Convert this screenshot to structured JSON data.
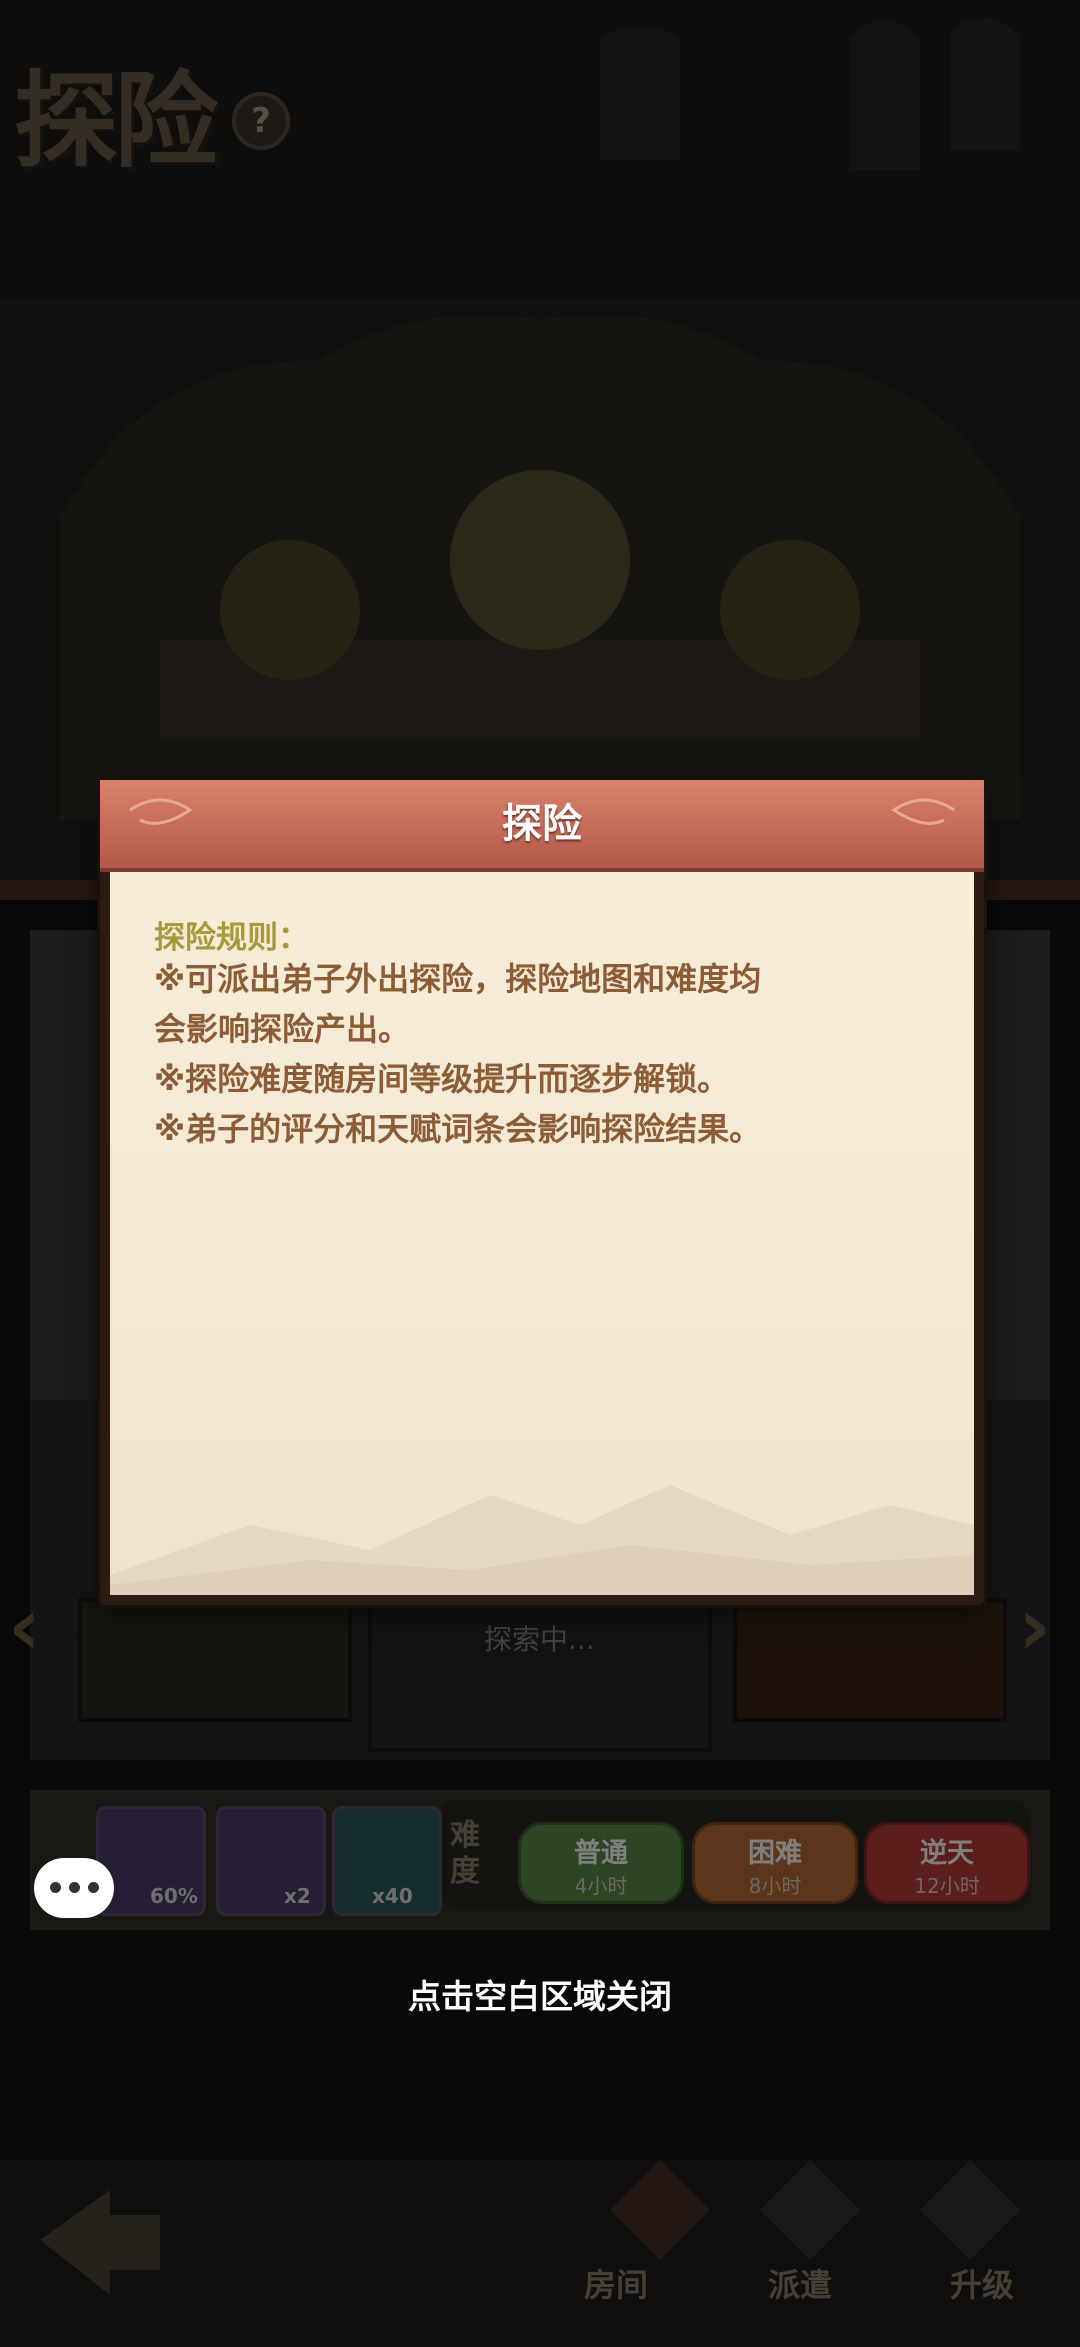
{
  "page": {
    "title": "探险"
  },
  "modal": {
    "title": "探险",
    "heading": "探险规则：",
    "rules": [
      "※可派出弟子外出探险，探险地图和难度均",
      "会影响探险产出。",
      "※探险难度随房间等级提升而逐步解锁。",
      "※弟子的评分和天赋词条会影响探险结果。"
    ]
  },
  "close_hint": "点击空白区域关闭",
  "background": {
    "explore_status": "探索中...",
    "difficulty_label": "难度",
    "difficulties": [
      {
        "name": "普通",
        "hours": "4小时"
      },
      {
        "name": "困难",
        "hours": "8小时"
      },
      {
        "name": "逆天",
        "hours": "12小时"
      }
    ],
    "items": [
      {
        "icon": "egg-icon",
        "count": "60%"
      },
      {
        "icon": "wolf-token-icon",
        "count": "x2"
      },
      {
        "icon": "scroll-icon",
        "count": "x40"
      }
    ],
    "nav": [
      {
        "label": "房间"
      },
      {
        "label": "派遣"
      },
      {
        "label": "升级"
      }
    ]
  },
  "colors": {
    "header": "#c46a58",
    "paper": "#f5ead6",
    "rule_text": "#8c5c36",
    "heading_text": "#a89a3a"
  }
}
